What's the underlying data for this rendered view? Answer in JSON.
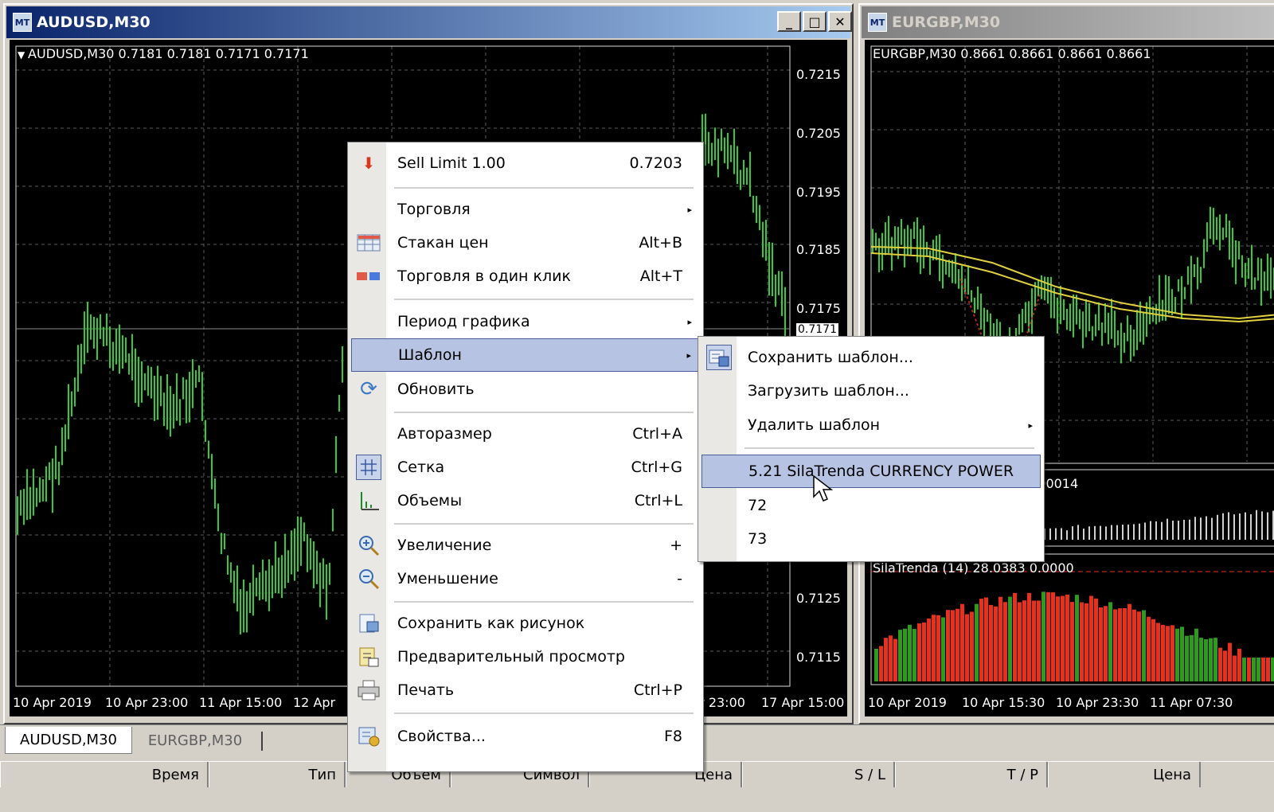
{
  "window_left": {
    "title": "AUDUSD,M30",
    "chart_header": "AUDUSD,M30  0.7181 0.7181 0.7171 0.7171",
    "prices": [
      "0.7215",
      "0.7205",
      "0.7195",
      "0.7185",
      "0.7175",
      "0.7171",
      "0.7125",
      "0.7115"
    ],
    "dates": [
      "10 Apr 2019",
      "10 Apr 23:00",
      "11 Apr 15:00",
      "12 Apr",
      "pr 23:00",
      "17 Apr 15:00"
    ],
    "minimize": "_",
    "maximize": "□",
    "close": "✕",
    "icon": "MT"
  },
  "window_right": {
    "title": "EURGBP,M30",
    "chart_header": "EURGBP,M30  0.8661 0.8661 0.8661 0.8661",
    "indicator1_value": "0.00014",
    "indicator2_header": "SilaTrenda (14) 28.0383 0.0000",
    "dates": [
      "10 Apr 2019",
      "10 Apr 15:30",
      "10 Apr 23:30",
      "11 Apr 07:30"
    ],
    "icon": "MT"
  },
  "context_menu": {
    "items": [
      {
        "label": "Sell Limit 1.00",
        "shortcut": "0.7203",
        "icon": "sell-arrow-icon"
      },
      {
        "label": "Торговля",
        "submenu": true
      },
      {
        "label": "Стакан цен",
        "shortcut": "Alt+B",
        "icon": "depth-of-market-icon"
      },
      {
        "label": "Торговля в один клик",
        "shortcut": "Alt+T",
        "icon": "one-click-trading-icon"
      },
      {
        "label": "Период графика",
        "submenu": true
      },
      {
        "label": "Шаблон",
        "submenu": true
      },
      {
        "label": "Обновить",
        "icon": "refresh-icon"
      },
      {
        "label": "Авторазмер",
        "shortcut": "Ctrl+A"
      },
      {
        "label": "Сетка",
        "shortcut": "Ctrl+G",
        "icon": "grid-icon"
      },
      {
        "label": "Объемы",
        "shortcut": "Ctrl+L",
        "icon": "volumes-icon"
      },
      {
        "label": "Увеличение",
        "shortcut": "+",
        "icon": "zoom-in-icon"
      },
      {
        "label": "Уменьшение",
        "shortcut": "-",
        "icon": "zoom-out-icon"
      },
      {
        "label": "Сохранить как рисунок",
        "icon": "save-picture-icon"
      },
      {
        "label": "Предварительный просмотр",
        "icon": "print-preview-icon"
      },
      {
        "label": "Печать",
        "shortcut": "Ctrl+P",
        "icon": "printer-icon"
      },
      {
        "label": "Свойства...",
        "shortcut": "F8",
        "icon": "properties-icon"
      }
    ]
  },
  "template_submenu": {
    "items": [
      {
        "label": "Сохранить шаблон...",
        "icon": "save-template-icon"
      },
      {
        "label": "Загрузить шаблон..."
      },
      {
        "label": "Удалить шаблон",
        "submenu": true
      },
      {
        "label": "5.21 SilaTrenda CURRENCY POWER",
        "highlighted": true
      },
      {
        "label": "72"
      },
      {
        "label": "73"
      }
    ]
  },
  "tabs": [
    "AUDUSD,M30",
    "EURGBP,M30"
  ],
  "column_headers": [
    "Время",
    "Тип",
    "Объем",
    "Символ",
    "Цена",
    "S / L",
    "T / P",
    "Цена"
  ],
  "colors": {
    "candle": "#33cc33",
    "highlight": "#b6c3e2",
    "title_active": "#0a246a",
    "histogram_red": "#e8301c",
    "histogram_green": "#2e9a1e"
  },
  "arrow_glyph": "▸"
}
